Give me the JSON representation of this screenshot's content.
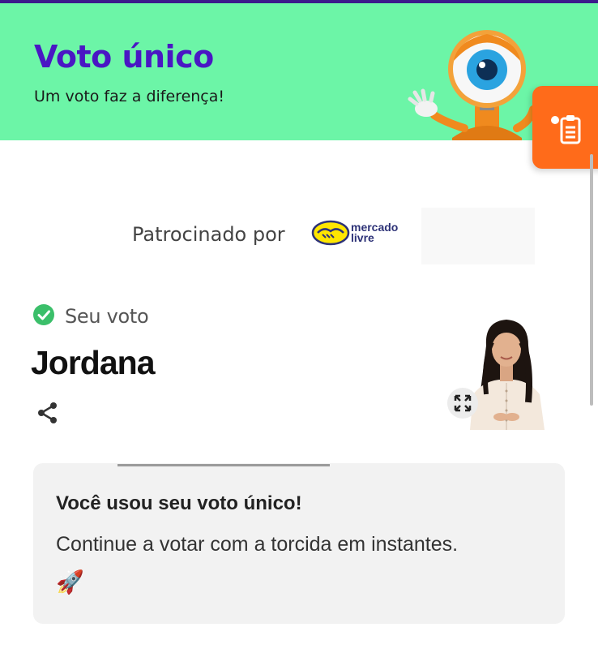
{
  "header": {
    "title": "Voto único",
    "subtitle": "Um voto faz a diferença!"
  },
  "sponsor": {
    "label": "Patrocinado por",
    "brand_line1": "mercado",
    "brand_line2": "livre"
  },
  "vote": {
    "status_label": "Seu voto",
    "candidate_name": "Jordana"
  },
  "result_card": {
    "title": "Você usou seu voto único!",
    "message": "Continue a votar com a torcida em instantes.",
    "emoji": "🚀"
  },
  "icons": {
    "check": "check-circle-icon",
    "share": "share-icon",
    "expand": "expand-icon",
    "side_tab": "clipboard-list-icon"
  },
  "colors": {
    "header_bg": "#6cf5a7",
    "title_purple": "#4a16c4",
    "accent_orange": "#ff6b1a",
    "check_green": "#3bbf6a"
  }
}
